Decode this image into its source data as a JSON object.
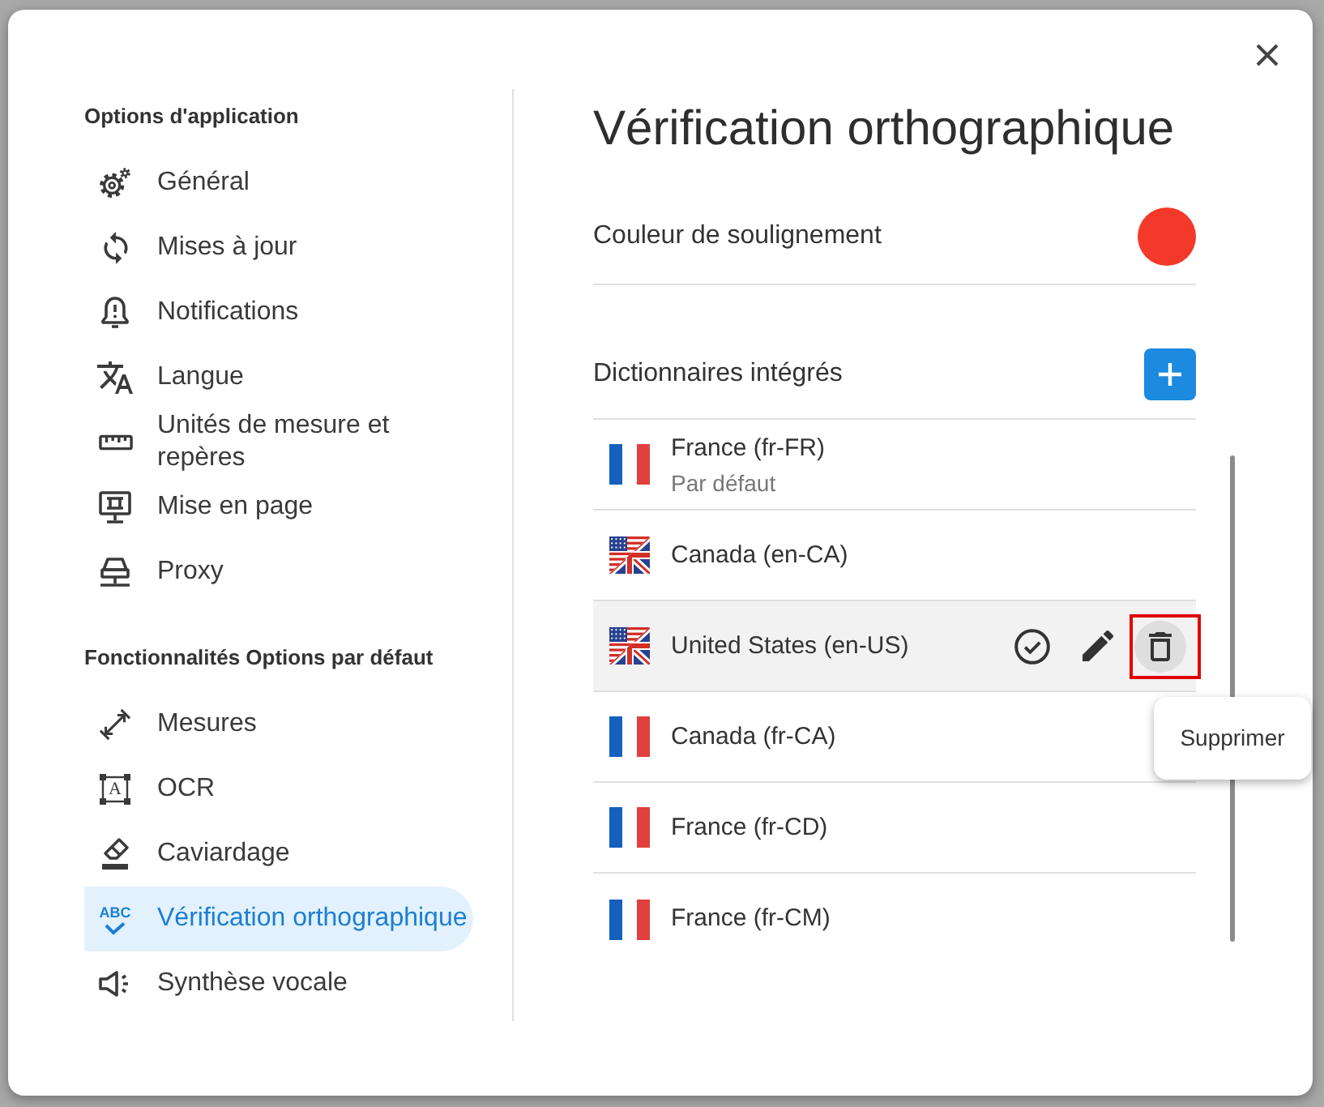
{
  "sidebar": {
    "sections": [
      {
        "heading": "Options d'application",
        "items": [
          {
            "label": "Général",
            "selected": false
          },
          {
            "label": "Mises à jour",
            "selected": false
          },
          {
            "label": "Notifications",
            "selected": false
          },
          {
            "label": "Langue",
            "selected": false
          },
          {
            "label": "Unités de mesure et repères",
            "selected": false
          },
          {
            "label": "Mise en page",
            "selected": false
          },
          {
            "label": "Proxy",
            "selected": false
          }
        ]
      },
      {
        "heading": "Fonctionnalités Options par défaut",
        "items": [
          {
            "label": "Mesures",
            "selected": false
          },
          {
            "label": "OCR",
            "selected": false,
            "icon_text": "A"
          },
          {
            "label": "Caviardage",
            "selected": false
          },
          {
            "label": "Vérification orthographique",
            "selected": true,
            "icon_text": "ABC"
          },
          {
            "label": "Synthèse vocale",
            "selected": false
          }
        ]
      }
    ]
  },
  "panel": {
    "title": "Vérification orthographique",
    "underline_color": {
      "label": "Couleur de soulignement",
      "color": "#f4392b"
    },
    "dictionaries": {
      "heading": "Dictionnaires intégrés",
      "items": [
        {
          "name": "France (fr-FR)",
          "note": "Par défaut",
          "kind": "french",
          "hovered": false,
          "delete_highlighted": false
        },
        {
          "name": "Canada (en-CA)",
          "kind": "english",
          "hovered": false,
          "delete_highlighted": false
        },
        {
          "name": "United States (en-US)",
          "kind": "english",
          "hovered": true,
          "delete_highlighted": true
        },
        {
          "name": "Canada (fr-CA)",
          "kind": "french",
          "hovered": false,
          "delete_highlighted": false
        },
        {
          "name": "France (fr-CD)",
          "kind": "french",
          "hovered": false,
          "delete_highlighted": false
        },
        {
          "name": "France (fr-CM)",
          "kind": "french",
          "hovered": false,
          "delete_highlighted": false
        }
      ]
    }
  },
  "tooltip": {
    "text": "Supprimer"
  }
}
